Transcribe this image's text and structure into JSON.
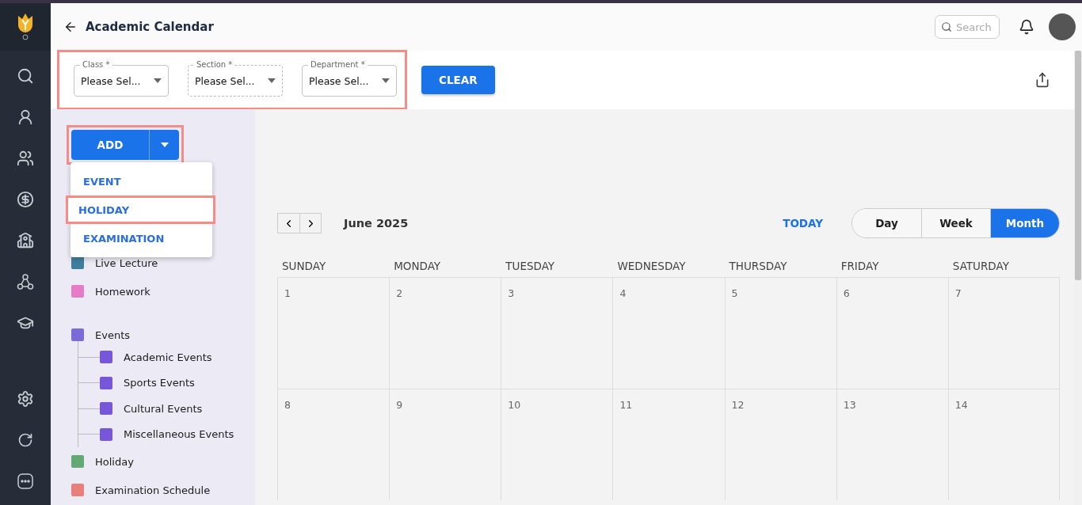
{
  "header": {
    "title": "Academic Calendar",
    "search": {
      "placeholder": "Search"
    }
  },
  "filters": {
    "highlighted": true,
    "fields": [
      {
        "label": "Class *",
        "value": "Please Sel...",
        "disabled": false
      },
      {
        "label": "Section *",
        "value": "Please Sel...",
        "disabled": true
      },
      {
        "label": "Department *",
        "value": "Please Sel...",
        "disabled": false
      }
    ],
    "clear_button": "CLEAR"
  },
  "add_button": {
    "label": "ADD",
    "highlighted": true
  },
  "add_menu": {
    "items": [
      {
        "label": "EVENT",
        "highlighted": false
      },
      {
        "label": "HOLIDAY",
        "highlighted": true
      },
      {
        "label": "EXAMINATION",
        "highlighted": false
      }
    ]
  },
  "legend": [
    {
      "label": "Live Lecture",
      "color": "#3f7f9e"
    },
    {
      "label": "Homework",
      "color": "#e57cc8"
    },
    {
      "label": "Events",
      "color": "#7b6bd8",
      "children": [
        {
          "label": "Academic Events",
          "color": "#7856d9"
        },
        {
          "label": "Sports Events",
          "color": "#7856d9"
        },
        {
          "label": "Cultural Events",
          "color": "#7856d9"
        },
        {
          "label": "Miscellaneous Events",
          "color": "#7856d9"
        }
      ]
    },
    {
      "label": "Holiday",
      "color": "#63a973"
    },
    {
      "label": "Examination Schedule",
      "color": "#e97f7b"
    }
  ],
  "calendar": {
    "title": "June 2025",
    "today": "TODAY",
    "views": [
      {
        "label": "Day",
        "selected": false
      },
      {
        "label": "Week",
        "selected": false
      },
      {
        "label": "Month",
        "selected": true
      }
    ],
    "weekdays": [
      "SUNDAY",
      "MONDAY",
      "TUESDAY",
      "WEDNESDAY",
      "THURSDAY",
      "FRIDAY",
      "SATURDAY"
    ],
    "weeks": [
      [
        "1",
        "2",
        "3",
        "4",
        "5",
        "6",
        "7"
      ],
      [
        "8",
        "9",
        "10",
        "11",
        "12",
        "13",
        "14"
      ]
    ]
  }
}
